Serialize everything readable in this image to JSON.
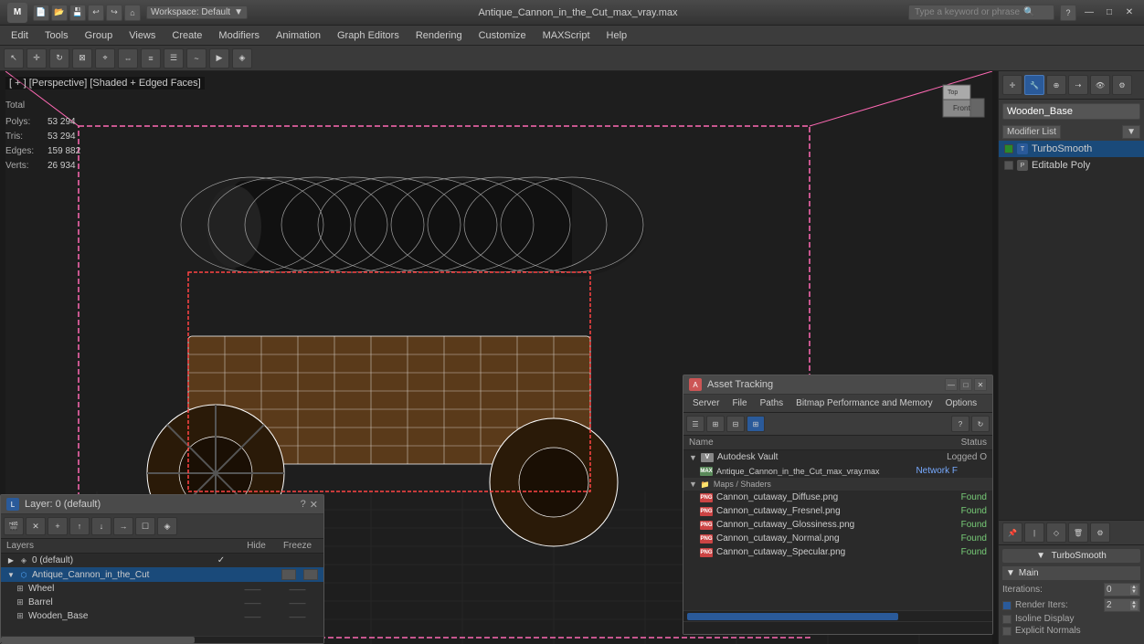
{
  "titlebar": {
    "logo": "M",
    "workspace_label": "Workspace: Default",
    "filename": "Antique_Cannon_in_the_Cut_max_vray.max",
    "search_placeholder": "Type a keyword or phrase",
    "minimize": "—",
    "maximize": "□",
    "close": "✕"
  },
  "menubar": {
    "items": [
      "Edit",
      "Tools",
      "Group",
      "Views",
      "Create",
      "Modifiers",
      "Animation",
      "Graph Editors",
      "Rendering",
      "Customize",
      "MAXScript",
      "Help"
    ]
  },
  "viewport": {
    "label": "[ + ] [Perspective] [Shaded + Edged Faces]",
    "stats": {
      "polys_label": "Polys:",
      "polys_val": "53 294",
      "tris_label": "Tris:",
      "tris_val": "53 294",
      "edges_label": "Edges:",
      "edges_val": "159 882",
      "verts_label": "Verts:",
      "verts_val": "26 934",
      "total_label": "Total"
    }
  },
  "right_panel": {
    "obj_name": "Wooden_Base",
    "modifier_list_label": "Modifier List",
    "modifiers": [
      {
        "name": "TurboSmooth",
        "active": true
      },
      {
        "name": "Editable Poly",
        "active": false
      }
    ],
    "params": {
      "title": "TurboSmooth",
      "main_label": "Main",
      "iterations_label": "Iterations:",
      "iterations_val": "0",
      "render_iters_label": "Render Iters:",
      "render_iters_val": "2",
      "isoline_label": "Isoline Display",
      "explicit_label": "Explicit Normals"
    }
  },
  "layers_panel": {
    "title": "Layer: 0 (default)",
    "close": "✕",
    "help": "?",
    "layers_col": "Layers",
    "hide_col": "Hide",
    "freeze_col": "Freeze",
    "items": [
      {
        "name": "0 (default)",
        "level": 0,
        "check": "✓",
        "hide": "",
        "freeze": "",
        "active": false
      },
      {
        "name": "Antique_Cannon_in_the_Cut",
        "level": 0,
        "check": "",
        "hide": "——",
        "freeze": "——",
        "active": true
      },
      {
        "name": "Wheel",
        "level": 1,
        "check": "",
        "hide": "——",
        "freeze": "——",
        "active": false
      },
      {
        "name": "Barrel",
        "level": 1,
        "check": "",
        "hide": "——",
        "freeze": "——",
        "active": false
      },
      {
        "name": "Wooden_Base",
        "level": 1,
        "check": "",
        "hide": "——",
        "freeze": "——",
        "active": false
      }
    ]
  },
  "asset_panel": {
    "title": "Asset Tracking",
    "close": "✕",
    "minimize": "—",
    "maximize": "□",
    "menu_items": [
      "Server",
      "File",
      "Paths",
      "Bitmap Performance and Memory",
      "Options"
    ],
    "name_col": "Name",
    "status_col": "Status",
    "items": [
      {
        "type": "group",
        "name": "Autodesk Vault",
        "status": "Logged O",
        "icon": "vault"
      },
      {
        "type": "file",
        "name": "Antique_Cannon_in_the_Cut_max_vray.max",
        "status": "Network F",
        "icon": "max"
      },
      {
        "type": "section",
        "name": "Maps / Shaders"
      },
      {
        "type": "file",
        "name": "Cannon_cutaway_Diffuse.png",
        "status": "Found",
        "icon": "png"
      },
      {
        "type": "file",
        "name": "Cannon_cutaway_Fresnel.png",
        "status": "Found",
        "icon": "png"
      },
      {
        "type": "file",
        "name": "Cannon_cutaway_Glossiness.png",
        "status": "Found",
        "icon": "png"
      },
      {
        "type": "file",
        "name": "Cannon_cutaway_Normal.png",
        "status": "Found",
        "icon": "png"
      },
      {
        "type": "file",
        "name": "Cannon_cutaway_Specular.png",
        "status": "Found",
        "icon": "png"
      }
    ]
  },
  "colors": {
    "accent_blue": "#1a4a7a",
    "found_green": "#7cc77c",
    "bg_dark": "#2a2a2a",
    "bg_mid": "#3a3a3a",
    "bg_light": "#4a4a4a",
    "border": "#222222",
    "text_normal": "#cccccc",
    "text_dim": "#aaaaaa"
  }
}
